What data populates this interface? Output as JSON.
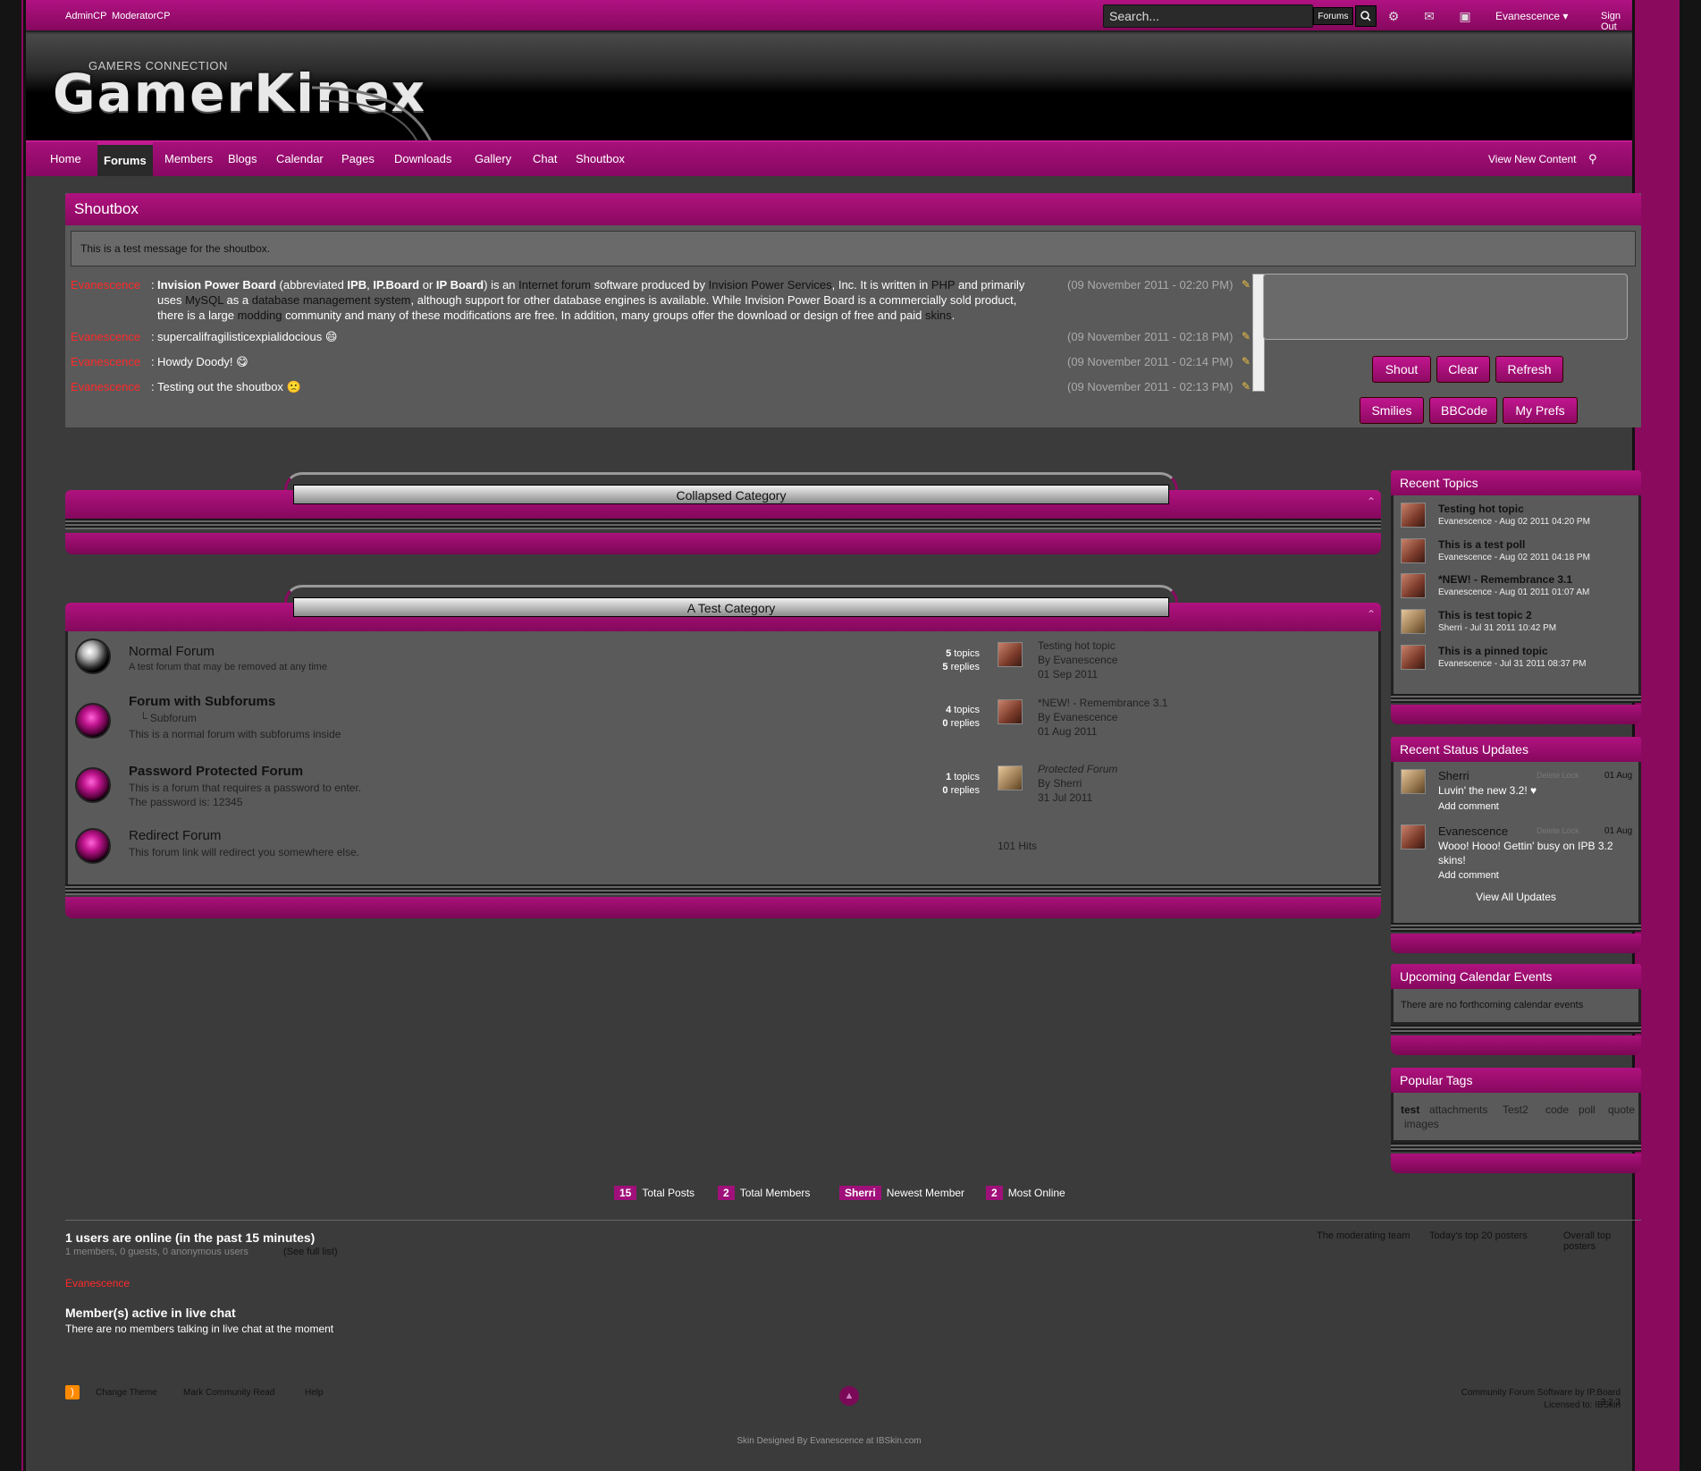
{
  "colors": {
    "accent": "#a0107a",
    "accent_dark": "#86085e",
    "username_red": "#ff2a2a",
    "panel": "#5a5a5a",
    "background": "#3b3b3b"
  },
  "topbar": {
    "links": [
      "AdminCP",
      "ModeratorCP"
    ],
    "search_placeholder": "Search...",
    "search_scope": "Forums",
    "icons": [
      "search-icon",
      "gear-icon",
      "mail-icon",
      "user-card-icon"
    ],
    "user_name": "Evanescence",
    "sign_out": "Sign Out"
  },
  "header": {
    "logo_small": "GAMERS CONNECTION",
    "logo_big": "GamerKinex"
  },
  "nav": {
    "items": [
      "Home",
      "Forums",
      "Members",
      "Blogs",
      "Calendar",
      "Pages",
      "Downloads",
      "Gallery",
      "Chat",
      "Shoutbox"
    ],
    "active": "Forums",
    "right_link": "View New Content",
    "right_icon": "map-pin-icon"
  },
  "shoutbox": {
    "title": "Shoutbox",
    "message": "This is a test message for the shoutbox.",
    "shouts": [
      {
        "user": "Evanescence",
        "sep": ":",
        "text_parts": [
          "Invision Power Board",
          " (abbreviated ",
          "IPB",
          ", ",
          "IP.Board",
          " or ",
          "IP Board",
          ") is an ",
          "Internet forum",
          " software produced by ",
          "Invision Power Services",
          ", Inc. It is written in ",
          "PHP",
          " and primarily uses ",
          "MySQL",
          " as a ",
          "database management system",
          ", although support for other database engines is available. While Invision Power Board is a commercially sold product, there is a large ",
          "modding",
          " community and many of these modifications are free. In addition, many groups offer the download or design of free and paid ",
          "skins",
          "."
        ],
        "time": "(09 November 2011 - 02:20 PM)"
      },
      {
        "user": "Evanescence",
        "sep": ":",
        "text": "supercalifragilisticexpialidocious",
        "emoji": "😄",
        "time": "(09 November 2011 - 02:18 PM)"
      },
      {
        "user": "Evanescence",
        "sep": ":",
        "text": "Howdy Doody!",
        "emoji": "😋",
        "time": "(09 November 2011 - 02:14 PM)"
      },
      {
        "user": "Evanescence",
        "sep": ":",
        "text": "Testing out the shoutbox",
        "emoji": "🙁",
        "time": "(09 November 2011 - 02:13 PM)"
      }
    ],
    "buttons_row1": [
      "Shout",
      "Clear",
      "Refresh"
    ],
    "buttons_row2": [
      "Smilies",
      "BBCode",
      "My Prefs"
    ]
  },
  "categories": [
    {
      "title": "Collapsed Category"
    },
    {
      "title": "A Test Category",
      "forums": [
        {
          "name": "Normal Forum",
          "desc": "A test forum that may be removed at any time",
          "topics": "5",
          "replies": "5",
          "topics_label": "topics",
          "replies_label": "replies",
          "last_title": "Testing hot topic",
          "by": "By",
          "last_user": "Evanescence",
          "last_date": "01 Sep 2011"
        },
        {
          "name": "Forum with Subforums",
          "subforum": "Subforum",
          "desc": "This is a normal forum with subforums inside",
          "topics": "4",
          "replies": "0",
          "topics_label": "topics",
          "replies_label": "replies",
          "last_title": "*NEW! - Remembrance 3.1",
          "by": "By",
          "last_user": "Evanescence",
          "last_date": "01 Aug 2011"
        },
        {
          "name": "Password Protected Forum",
          "desc": "This is a forum that requires a password to enter.",
          "desc2": "The password is: 12345",
          "topics": "1",
          "replies": "0",
          "topics_label": "topics",
          "replies_label": "replies",
          "last_title": "Protected Forum",
          "by": "By",
          "last_user": "Sherri",
          "last_date": "31 Jul 2011"
        },
        {
          "name": "Redirect Forum",
          "desc": "This forum link will redirect you somewhere else.",
          "hits": "101 Hits"
        }
      ]
    }
  ],
  "sidebar": {
    "recent_topics": {
      "title": "Recent Topics",
      "items": [
        {
          "title": "Testing hot topic",
          "meta": "Evanescence - Aug 02 2011 04:20 PM"
        },
        {
          "title": "This is a test poll",
          "meta": "Evanescence - Aug 02 2011 04:18 PM"
        },
        {
          "title": "*NEW! - Remembrance 3.1",
          "meta": "Evanescence - Aug 01 2011 01:07 AM"
        },
        {
          "title": "This is test topic 2",
          "meta": "Sherri - Jul 31 2011 10:42 PM"
        },
        {
          "title": "This is a pinned topic",
          "meta": "Evanescence - Jul 31 2011 08:37 PM"
        }
      ]
    },
    "status_updates": {
      "title": "Recent Status Updates",
      "items": [
        {
          "name": "Sherri",
          "actions": "Delete  Lock",
          "date": "01 Aug",
          "text": "Luvin' the new 3.2! ♥",
          "add": "Add comment"
        },
        {
          "name": "Evanescence",
          "actions": "Delete  Lock",
          "date": "01 Aug",
          "text": "Wooo! Hooo! Gettin' busy on IPB 3.2 skins!",
          "add": "Add comment"
        }
      ],
      "view_all": "View All Updates"
    },
    "calendar": {
      "title": "Upcoming Calendar Events",
      "empty": "There are no forthcoming calendar events"
    },
    "tags": {
      "title": "Popular Tags",
      "items": [
        "test",
        "attachments",
        "Test2",
        "code",
        "poll",
        "quote",
        "images"
      ]
    }
  },
  "stats": [
    {
      "num": "15",
      "label": "Total Posts"
    },
    {
      "num": "2",
      "label": "Total Members"
    },
    {
      "num": "Sherri",
      "label": "Newest Member"
    },
    {
      "num": "2",
      "label": "Most Online"
    }
  ],
  "online": {
    "heading": "1 users are online (in the past 15 minutes)",
    "counts": "1 members, 0 guests, 0 anonymous users",
    "full_list": "(See full list)",
    "user": "Evanescence",
    "right_links": [
      "The moderating team",
      "Today's top 20 posters",
      "Overall top posters"
    ],
    "chat_heading": "Member(s) active in live chat",
    "chat_text": "There are no members talking in live chat at the moment"
  },
  "footer": {
    "links": [
      "Change Theme",
      "Mark Community Read",
      "Help"
    ],
    "rss_icon": "rss-icon",
    "top_icon": "back-to-top-icon",
    "copyright": "Community Forum Software by IP.Board 3.2.3",
    "licensed": "Licensed to: IBSkin",
    "skin_credit": "Skin Designed By Evanescence at IBSkin.com"
  }
}
